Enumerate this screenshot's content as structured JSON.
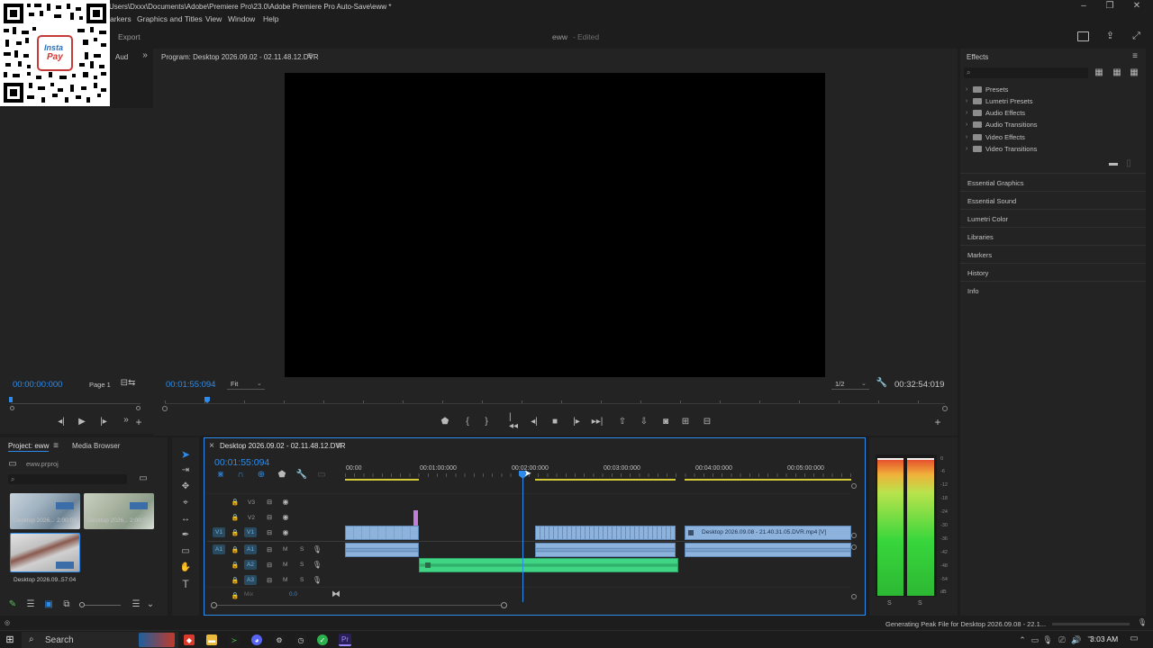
{
  "window": {
    "title": "Users\\Dxxx\\Documents\\Adobe\\Premiere Pro\\23.0\\Adobe Premiere Pro Auto-Save\\eww *",
    "minimize": "–",
    "restore": "❐",
    "close": "✕"
  },
  "menu": {
    "items": [
      "arkers",
      "Graphics and Titles",
      "View",
      "Window",
      "Help"
    ]
  },
  "header": {
    "export_label": "Export",
    "project_name": "eww",
    "status": "Edited"
  },
  "qr": {
    "logo_text_1": "Insta",
    "logo_text_2": "Pay"
  },
  "source_panel": {
    "tab_label": "Aud",
    "timecode": "00:00:00:000",
    "page_label": "Page 1"
  },
  "program": {
    "title": "Program: Desktop 2026.09.02 - 02.11.48.12.DVR",
    "playhead_timecode": "00:01:55:094",
    "fit_label": "Fit",
    "resolution": "1/2",
    "duration": "00:32:54:019"
  },
  "effects": {
    "title": "Effects",
    "folders": [
      "Presets",
      "Lumetri Presets",
      "Audio Effects",
      "Audio Transitions",
      "Video Effects",
      "Video Transitions"
    ],
    "panels": [
      "Essential Graphics",
      "Essential Sound",
      "Lumetri Color",
      "Libraries",
      "Markers",
      "History",
      "Info"
    ]
  },
  "project": {
    "tab_label": "Project: eww",
    "tab_media_browser": "Media Browser",
    "file_name": "eww.prproj",
    "items": [
      {
        "name": "Desktop 2026...",
        "duration": "2:00:03"
      },
      {
        "name": "Desktop 2026...",
        "duration": "2:00:21"
      },
      {
        "name": "Desktop 2026.09...",
        "duration": "57:04"
      }
    ]
  },
  "timeline": {
    "sequence_name": "Desktop 2026.09.02 - 02.11.48.12.DVR",
    "timecode": "00:01:55:094",
    "ruler": [
      "00:00",
      "00:01:00:000",
      "00:02:00:000",
      "00:03:00:000",
      "00:04:00:000",
      "00:05:00:000"
    ],
    "tracks": {
      "video": [
        "V3",
        "V2",
        "V1"
      ],
      "audio": [
        "A1",
        "A2",
        "A3"
      ],
      "mix_label": "Mix",
      "mix_value": "0.0",
      "m_label": "M",
      "s_label": "S"
    },
    "clip_label": "Desktop 2026.09.08 - 21.40.31.05.DVR.mp4 [V]"
  },
  "meter": {
    "scale": [
      "0",
      "-6",
      "-12",
      "-18",
      "-24",
      "-30",
      "-36",
      "-42",
      "-48",
      "-54",
      "dB"
    ],
    "solo_left": "S",
    "solo_right": "S"
  },
  "status_bar": {
    "message": "Generating Peak File for Desktop 2026.09.08 - 22.1..."
  },
  "taskbar": {
    "search_placeholder": "Search",
    "time": "3:03 AM"
  },
  "colors": {
    "accent": "#2d8ceb",
    "video_clip": "#8db3dc",
    "audio_clip_green": "#3fd584",
    "meter_red": "#e5452b",
    "meter_green": "#38d63c"
  }
}
